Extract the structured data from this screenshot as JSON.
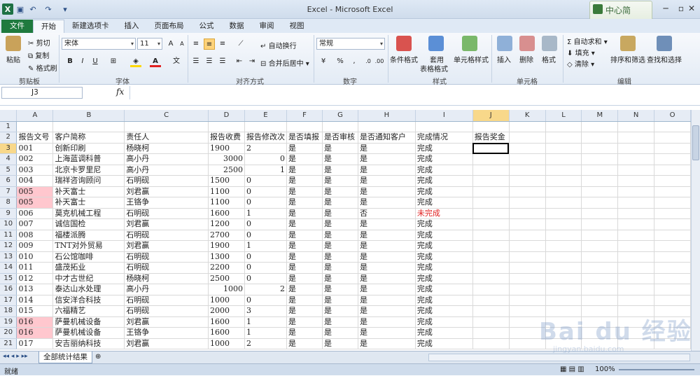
{
  "window": {
    "title": "Excel - Microsoft Excel",
    "logo_letter": "X"
  },
  "quick_access": {
    "save": "▣",
    "undo": "↶",
    "redo": "↷",
    "open": "▾"
  },
  "ribbon_tabs": [
    "文件",
    "开始",
    "新建选项卡",
    "插入",
    "页面布局",
    "公式",
    "数据",
    "审阅",
    "视图"
  ],
  "ribbon": {
    "clipboard": {
      "paste": "粘贴",
      "cut": "剪切",
      "copy": "复制",
      "painter": "格式刷",
      "label": "剪贴板"
    },
    "font": {
      "name": "宋体",
      "size": "11",
      "label": "字体",
      "bold": "B",
      "italic": "I",
      "underline": "U"
    },
    "alignment": {
      "wrap": "自动换行",
      "merge": "合并后居中",
      "label": "对齐方式"
    },
    "number": {
      "format": "常规",
      "label": "数字",
      "percent": "%"
    },
    "styles": {
      "conditional": "条件格式",
      "table_l1": "套用",
      "table_l2": "表格格式",
      "cell": "单元格样式",
      "label": "样式"
    },
    "cells": {
      "insert": "插入",
      "delete": "删除",
      "format": "格式",
      "label": "单元格"
    },
    "editing": {
      "autosum": "自动求和",
      "fill": "填充",
      "clear": "清除",
      "sort": "排序和筛选",
      "find": "查找和选择",
      "label": "编辑"
    }
  },
  "watermark_badge": "中心简",
  "formula_bar": {
    "name_box": "J3",
    "fx": "fx",
    "content": ""
  },
  "columns": [
    "A",
    "B",
    "C",
    "D",
    "E",
    "F",
    "G",
    "H",
    "I",
    "J",
    "K",
    "L",
    "M",
    "N",
    "O"
  ],
  "rows": [
    {
      "n": "1",
      "cells": [
        "",
        "",
        "",
        "",
        "",
        "",
        "",
        "",
        "",
        ""
      ]
    },
    {
      "n": "2",
      "cells": [
        "报告文号",
        "客户简称",
        "责任人",
        "报告收费",
        "报告修改次",
        "是否填报",
        "是否审核",
        "是否通知客户",
        "完成情况",
        "报告奖金"
      ]
    },
    {
      "n": "3",
      "cells": [
        "001",
        "创新印刷",
        "杨晓柯",
        "1900",
        "2",
        "是",
        "是",
        "是",
        "完成",
        ""
      ]
    },
    {
      "n": "4",
      "cells": [
        "002",
        "上海蓝调科普",
        "高小丹",
        "3000",
        "0",
        "是",
        "是",
        "是",
        "完成",
        ""
      ]
    },
    {
      "n": "5",
      "cells": [
        "003",
        "北京卡罗里尼",
        "高小丹",
        "2500",
        "1",
        "是",
        "是",
        "是",
        "完成",
        ""
      ]
    },
    {
      "n": "6",
      "cells": [
        "004",
        "瑞祥咨询顾问",
        "石明砚",
        "1500",
        "0",
        "是",
        "是",
        "是",
        "完成",
        ""
      ]
    },
    {
      "n": "7",
      "cells": [
        "005",
        "补天富士",
        "刘君赢",
        "1100",
        "0",
        "是",
        "是",
        "是",
        "完成",
        ""
      ]
    },
    {
      "n": "8",
      "cells": [
        "005",
        "补天富士",
        "王铬争",
        "1100",
        "0",
        "是",
        "是",
        "是",
        "完成",
        ""
      ]
    },
    {
      "n": "9",
      "cells": [
        "006",
        "莫克机械工程",
        "石明砚",
        "1600",
        "1",
        "是",
        "是",
        "否",
        "未完成",
        ""
      ]
    },
    {
      "n": "10",
      "cells": [
        "007",
        "诚信国检",
        "刘君赢",
        "1200",
        "0",
        "是",
        "是",
        "是",
        "完成",
        ""
      ]
    },
    {
      "n": "11",
      "cells": [
        "008",
        "福楼派腾",
        "石明砚",
        "2700",
        "0",
        "是",
        "是",
        "是",
        "完成",
        ""
      ]
    },
    {
      "n": "12",
      "cells": [
        "009",
        "TNT对外贸易",
        "刘君赢",
        "1900",
        "1",
        "是",
        "是",
        "是",
        "完成",
        ""
      ]
    },
    {
      "n": "13",
      "cells": [
        "010",
        "石公馆咖啡",
        "石明砚",
        "1300",
        "0",
        "是",
        "是",
        "是",
        "完成",
        ""
      ]
    },
    {
      "n": "14",
      "cells": [
        "011",
        "盛茂拓业",
        "石明砚",
        "2200",
        "0",
        "是",
        "是",
        "是",
        "完成",
        ""
      ]
    },
    {
      "n": "15",
      "cells": [
        "012",
        "中才古世纪",
        "杨晓柯",
        "2500",
        "0",
        "是",
        "是",
        "是",
        "完成",
        ""
      ]
    },
    {
      "n": "16",
      "cells": [
        "013",
        "泰达山水处理",
        "高小丹",
        "1000",
        "2",
        "是",
        "是",
        "是",
        "完成",
        ""
      ]
    },
    {
      "n": "17",
      "cells": [
        "014",
        "信安洋合科技",
        "石明砚",
        "1000",
        "0",
        "是",
        "是",
        "是",
        "完成",
        ""
      ]
    },
    {
      "n": "18",
      "cells": [
        "015",
        "六福精艺",
        "石明砚",
        "2000",
        "3",
        "是",
        "是",
        "是",
        "完成",
        ""
      ]
    },
    {
      "n": "19",
      "cells": [
        "016",
        "萨曼机械设备",
        "刘君赢",
        "1600",
        "1",
        "是",
        "是",
        "是",
        "完成",
        ""
      ]
    },
    {
      "n": "20",
      "cells": [
        "016",
        "萨曼机械设备",
        "王铬争",
        "1600",
        "1",
        "是",
        "是",
        "是",
        "完成",
        ""
      ]
    },
    {
      "n": "21",
      "cells": [
        "017",
        "安吉丽纳科技",
        "刘君赢",
        "1000",
        "2",
        "是",
        "是",
        "是",
        "完成",
        ""
      ]
    }
  ],
  "sheet_tab": "全部统计结果",
  "status": {
    "ready": "就绪",
    "zoom": "100%"
  },
  "watermark": {
    "brand": "Bai du 经验",
    "url": "jingyan.baidu.com"
  }
}
